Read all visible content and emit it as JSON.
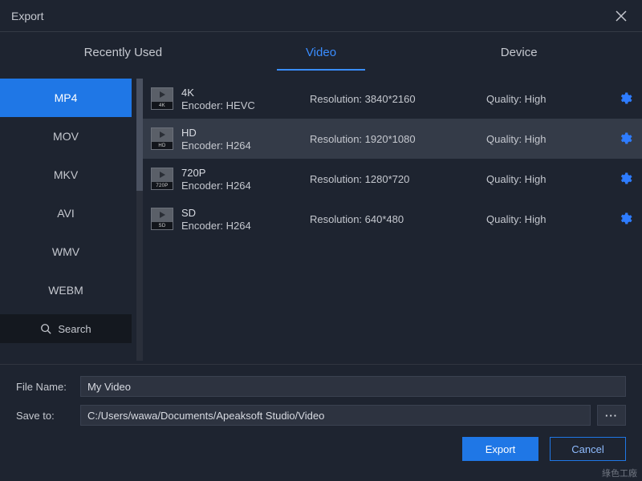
{
  "title": "Export",
  "tabs": [
    "Recently Used",
    "Video",
    "Device"
  ],
  "active_tab": 1,
  "formats": [
    "MP4",
    "MOV",
    "MKV",
    "AVI",
    "WMV",
    "WEBM"
  ],
  "active_format": 0,
  "search_label": "Search",
  "presets": [
    {
      "name": "4K",
      "badge": "4K",
      "encoder": "Encoder: HEVC",
      "resolution": "Resolution: 3840*2160",
      "quality": "Quality: High",
      "selected": false
    },
    {
      "name": "HD",
      "badge": "HD",
      "encoder": "Encoder: H264",
      "resolution": "Resolution: 1920*1080",
      "quality": "Quality: High",
      "selected": true
    },
    {
      "name": "720P",
      "badge": "720P",
      "encoder": "Encoder: H264",
      "resolution": "Resolution: 1280*720",
      "quality": "Quality: High",
      "selected": false
    },
    {
      "name": "SD",
      "badge": "SD",
      "encoder": "Encoder: H264",
      "resolution": "Resolution: 640*480",
      "quality": "Quality: High",
      "selected": false
    }
  ],
  "file_name_label": "File Name:",
  "file_name_value": "My Video",
  "save_to_label": "Save to:",
  "save_to_value": "C:/Users/wawa/Documents/Apeaksoft Studio/Video",
  "browse_label": "···",
  "export_label": "Export",
  "cancel_label": "Cancel",
  "watermark": "綠色工廠"
}
